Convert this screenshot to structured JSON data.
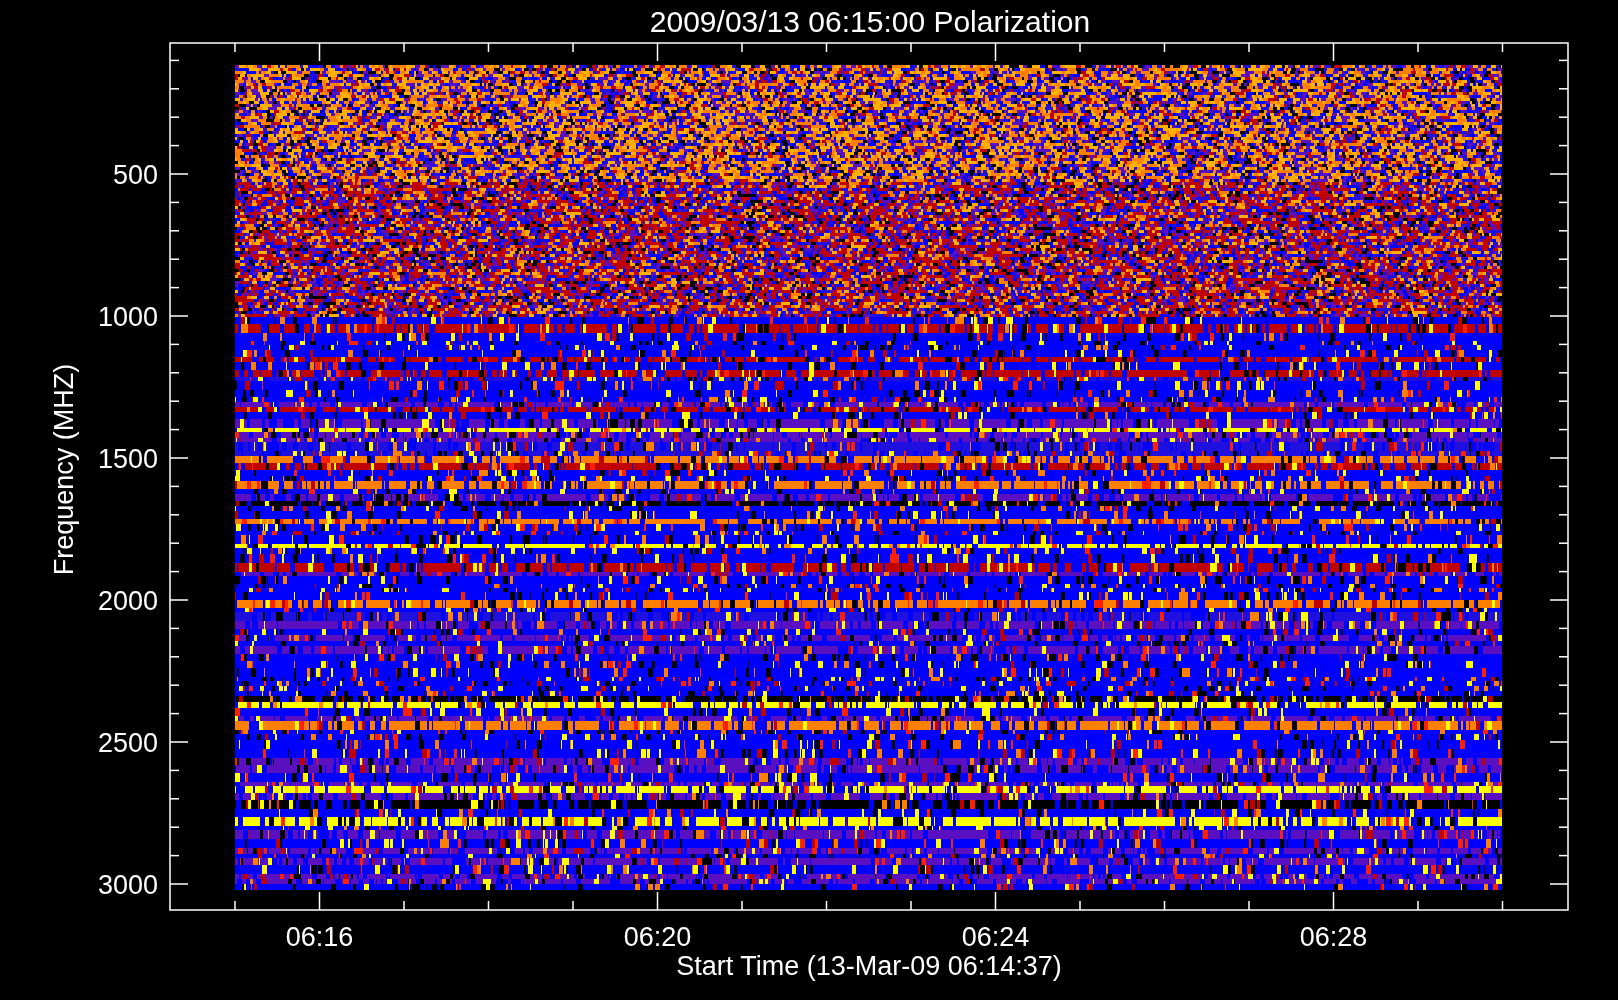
{
  "plot": {
    "title": "2009/03/13 06:15:00 Polarization",
    "ylabel": "Frequency (MHZ)",
    "xlabel": "Start Time (13-Mar-09 06:14:37)",
    "y_tick_labels": [
      "500",
      "1000",
      "1500",
      "2000",
      "2500",
      "3000"
    ],
    "x_tick_labels": [
      "06:16",
      "06:20",
      "06:24",
      "06:28"
    ]
  }
}
